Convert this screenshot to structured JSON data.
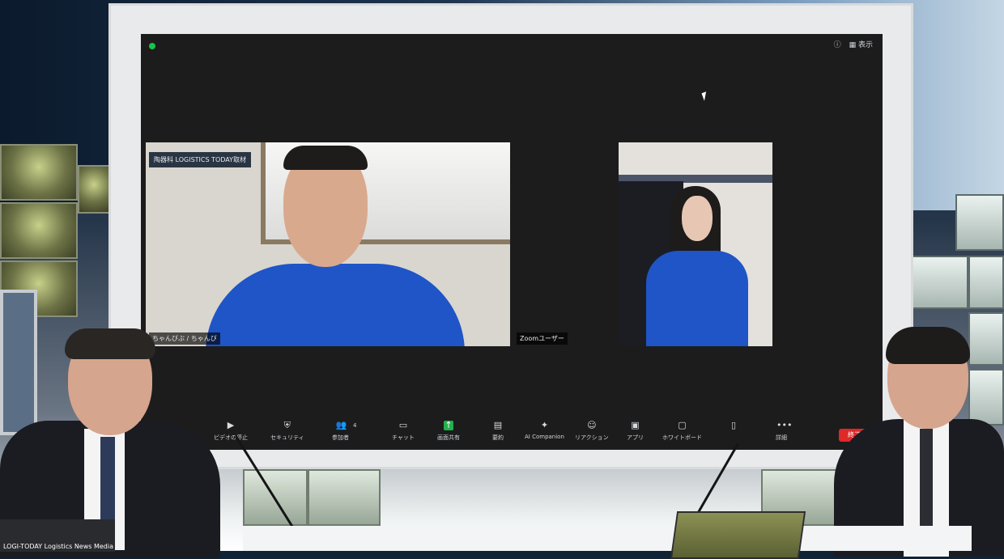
{
  "meeting": {
    "top_right_label": "表示",
    "left_tile": {
      "banner": "陶器科 LOGISTICS TODAY取材",
      "name_label": "ちゃんびぶ / ちゃんび"
    },
    "right_tile": {
      "name_label": "Zoomユーザー"
    }
  },
  "toolbar": {
    "items": [
      {
        "label": "ビデオの停止",
        "icon": "video-icon"
      },
      {
        "label": "セキュリティ",
        "icon": "shield-icon"
      },
      {
        "label": "参加者",
        "icon": "participants-icon",
        "count": "4"
      },
      {
        "label": "チャット",
        "icon": "chat-icon"
      },
      {
        "label": "画面共有",
        "icon": "share-screen-icon"
      },
      {
        "label": "要約",
        "icon": "summary-icon"
      },
      {
        "label": "AI Companion",
        "icon": "ai-companion-icon"
      },
      {
        "label": "リアクション",
        "icon": "reaction-icon"
      },
      {
        "label": "アプリ",
        "icon": "apps-icon"
      },
      {
        "label": "ホワイトボード",
        "icon": "whiteboard-icon"
      },
      {
        "label": "",
        "icon": "notes-icon"
      },
      {
        "label": "詳細",
        "icon": "more-icon"
      }
    ],
    "end_label": "終了"
  },
  "ticker": "LOGI-TODAY Logistics News Media"
}
